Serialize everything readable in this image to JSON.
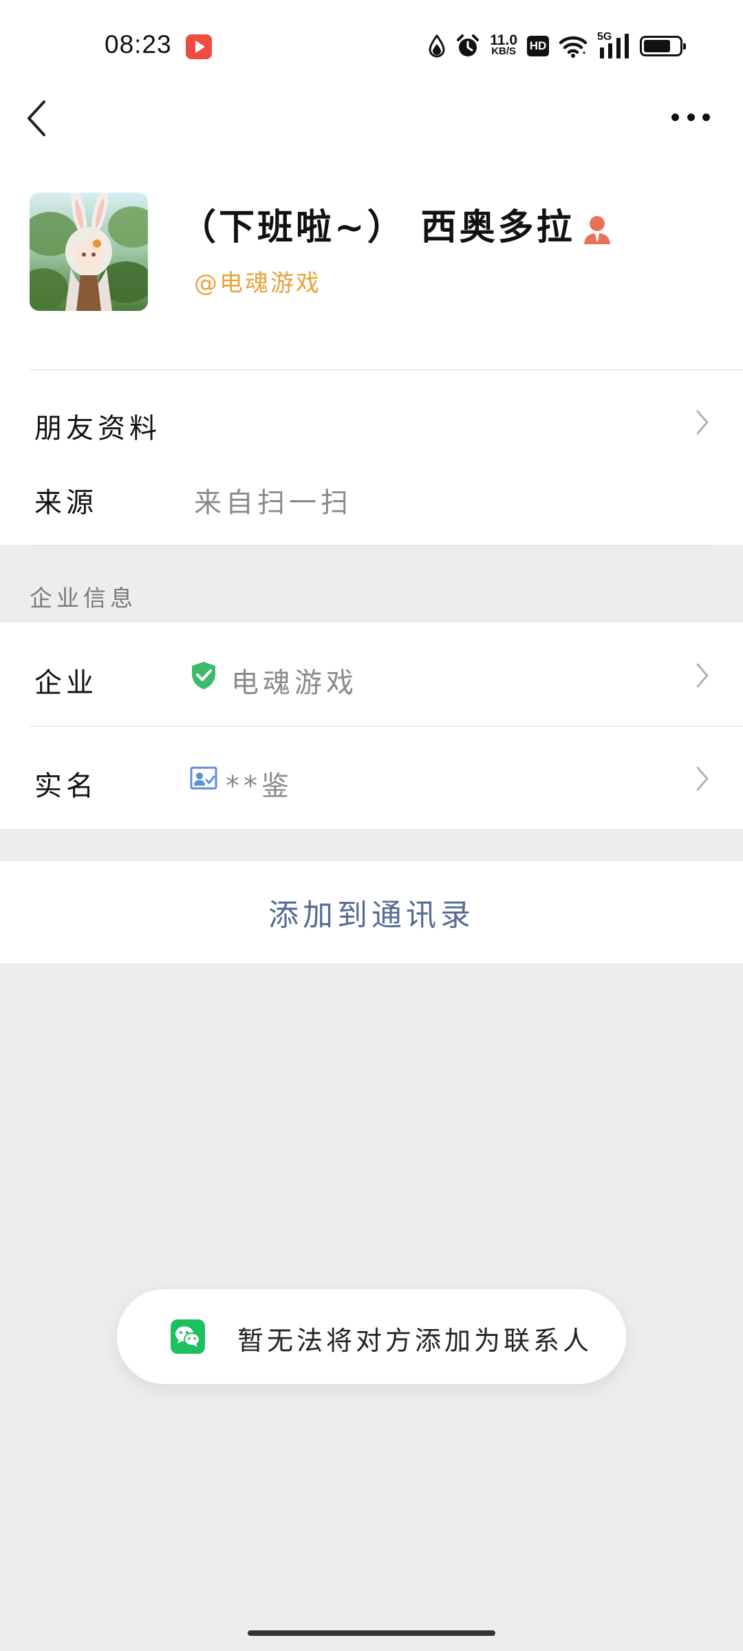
{
  "status_bar": {
    "time": "08:23",
    "net_speed_value": "11.0",
    "net_speed_unit": "KB/S",
    "hd_label": "HD",
    "network_label": "5G",
    "battery_level": 0.75,
    "icons": [
      "video-app-icon",
      "data-saver-icon",
      "alarm-icon",
      "wifi-icon",
      "signal-icon",
      "battery-icon"
    ]
  },
  "header": {
    "back_icon": "chevron-left-icon",
    "more_icon": "more-dots-icon"
  },
  "profile": {
    "name": "（下班啦~） 西奥多拉",
    "company_tag": "@电魂游戏",
    "badge_icon": "person-badge-icon",
    "badge_color": "#e8715a"
  },
  "info_rows": {
    "friend_profile_label": "朋友资料",
    "source_label": "来源",
    "source_value": "来自扫一扫"
  },
  "enterprise": {
    "section_title": "企业信息",
    "company_label": "企业",
    "company_value": "电魂游戏",
    "company_icon": "verified-shield-icon",
    "realname_label": "实名",
    "realname_value": "**鉴",
    "realname_icon": "id-card-icon"
  },
  "actions": {
    "add_to_contacts": "添加到通讯录",
    "link_color": "#576b95"
  },
  "toast": {
    "message": "暂无法将对方添加为联系人",
    "icon": "wechat-icon",
    "icon_color": "#19c15f"
  }
}
